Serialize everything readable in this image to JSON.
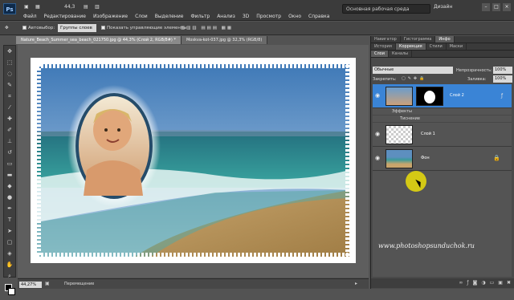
{
  "menubar": {
    "logo": "Ps",
    "zoom": "44,3",
    "items": [
      "Файл",
      "Редактирование",
      "Изображение",
      "Слои",
      "Выделение",
      "Фильтр",
      "Анализ",
      "3D",
      "Просмотр",
      "Окно",
      "Справка"
    ],
    "workspace": "Основная рабочая среда",
    "workspace2": "Дизайн"
  },
  "options": {
    "autoselect": "Автовыбор:",
    "group": "Группы слоев",
    "show_controls": "Показать управляющие элементы"
  },
  "tabs": [
    {
      "label": "Nature_Beach_Summer_sea_beach_021750.jpg @ 44,3% (Слой 2, RGB/8#) *"
    },
    {
      "label": "Moskva-kot-037.jpg @ 32,3% (RGB/8)"
    }
  ],
  "status": {
    "zoom": "44,27%",
    "text": "Перемещение"
  },
  "panel": {
    "top_tabs": [
      "Навигатор",
      "Гистограмма",
      "Инфо"
    ],
    "tabs2": [
      "История",
      "Коррекция",
      "Стили",
      "Маски"
    ],
    "tabs3": [
      "Слои",
      "Каналы"
    ],
    "blend_mode": "Обычные",
    "opacity_label": "Непрозрачность:",
    "opacity": "100%",
    "lock_label": "Закрепить:",
    "fill_label": "Заливка:",
    "fill": "100%",
    "layers": [
      {
        "name": "Слой 2"
      },
      {
        "name": "Слой 1"
      },
      {
        "name": "Фон"
      }
    ],
    "effects_label": "Эффекты",
    "effect_item": "Тиснение",
    "watermark": "www.photoshopsunduchok.ru"
  },
  "colors": {
    "accent": "#3a84d6",
    "highlight": "#ffee00"
  }
}
